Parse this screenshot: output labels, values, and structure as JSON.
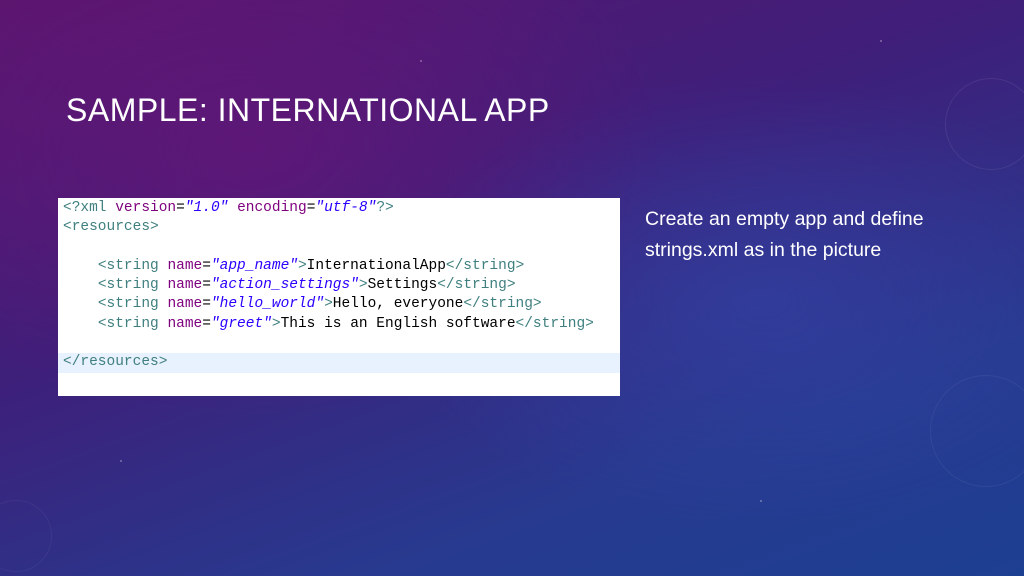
{
  "slide": {
    "title": "SAMPLE: INTERNATIONAL APP",
    "description": "Create an empty app and define strings.xml as in the picture"
  },
  "code": {
    "xml_decl": {
      "open": "<?xml",
      "attr1": "version",
      "val1": "\"1.0\"",
      "attr2": "encoding",
      "val2": "\"utf-8\"",
      "close": "?>"
    },
    "resources_open": "<resources>",
    "resources_close": "</resources>",
    "strings": [
      {
        "name": "\"app_name\"",
        "value": "InternationalApp"
      },
      {
        "name": "\"action_settings\"",
        "value": "Settings"
      },
      {
        "name": "\"hello_world\"",
        "value": "Hello, everyone"
      },
      {
        "name": "\"greet\"",
        "value": "This is an English software"
      }
    ],
    "string_open": "<string",
    "string_attr": "name",
    "string_close": "</string>"
  },
  "colors": {
    "tag": "#3f7f7f",
    "attribute": "#7f007f",
    "value": "#2a00ff",
    "highlight_line": "#e8f2fe"
  }
}
